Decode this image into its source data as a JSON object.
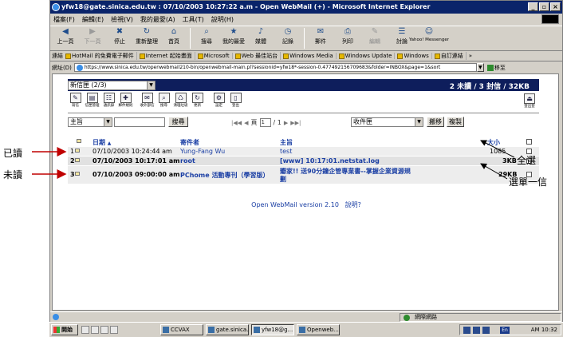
{
  "window": {
    "title": "yfw18@gate.sinica.edu.tw : 07/10/2003 10:27:22 a.m - Open WebMail (+) - Microsoft Internet Explorer",
    "buttons": [
      "_",
      "▫",
      "×"
    ]
  },
  "menu": [
    "檔案(F)",
    "編輯(E)",
    "檢視(V)",
    "我的最愛(A)",
    "工具(T)",
    "說明(H)"
  ],
  "toolbar": [
    {
      "label": "上一頁",
      "icon": "back-icon",
      "disabled": false
    },
    {
      "label": "下一頁",
      "icon": "forward-icon",
      "disabled": true
    },
    {
      "label": "停止",
      "icon": "stop-icon",
      "disabled": false
    },
    {
      "label": "重新整理",
      "icon": "refresh-icon",
      "disabled": false
    },
    {
      "label": "首頁",
      "icon": "home-icon",
      "disabled": false
    },
    {
      "label": "搜尋",
      "icon": "search-icon",
      "disabled": false
    },
    {
      "label": "我的最愛",
      "icon": "favorites-icon",
      "disabled": false
    },
    {
      "label": "媒體",
      "icon": "media-icon",
      "disabled": false
    },
    {
      "label": "記錄",
      "icon": "history-icon",
      "disabled": false
    },
    {
      "label": "郵件",
      "icon": "mail-icon",
      "disabled": false
    },
    {
      "label": "列印",
      "icon": "print-icon",
      "disabled": false
    },
    {
      "label": "編輯",
      "icon": "edit-icon",
      "disabled": true
    },
    {
      "label": "討論",
      "icon": "discuss-icon",
      "disabled": false
    },
    {
      "label": "Yahoo! Messenger",
      "icon": "messenger-icon",
      "disabled": false
    }
  ],
  "links": {
    "label": "連結",
    "items": [
      "HotMail 的免費電子郵件",
      "Internet 起始畫面",
      "Microsoft",
      "Web 最佳站台",
      "Windows Media",
      "Windows Update",
      "Windows",
      "自訂連結"
    ],
    "more": "»"
  },
  "address": {
    "label": "網址(D)",
    "url": "https://www.sinica.edu.tw/openwebmail210-bin/openwebmail-main.pl?sessionid=yfw18*-session-0.477492156709683&folder=INBOX&page=1&sort",
    "go": "移至"
  },
  "webmail": {
    "folder_select": "新信匣 (2/3)",
    "status": "2 未讀 / 3 封信 / 32KB",
    "icons": [
      {
        "name": "compose-icon",
        "label": "寫信",
        "glyph": "✎"
      },
      {
        "name": "folders-icon",
        "label": "信匣管理",
        "glyph": "▤"
      },
      {
        "name": "addressbook-icon",
        "label": "通訊錄",
        "glyph": "☷"
      },
      {
        "name": "filter-icon",
        "label": "郵件規則",
        "glyph": "✚"
      },
      {
        "name": "pop3-icon",
        "label": "收外部信",
        "glyph": "✉"
      },
      {
        "name": "search-mail-icon",
        "label": "搜尋",
        "glyph": "⌕"
      },
      {
        "name": "trash-icon",
        "label": "清理垃圾",
        "glyph": "♺"
      },
      {
        "name": "update-icon",
        "label": "更新",
        "glyph": "↻"
      },
      {
        "name": "settings-icon",
        "label": "設定",
        "glyph": "⚙"
      },
      {
        "name": "logout-door-icon",
        "label": "登出",
        "glyph": "▯"
      }
    ],
    "logout_label": "登出登",
    "search": {
      "field_select": "主旨",
      "keyword": "",
      "button": "搜尋",
      "page_label": "頁",
      "page_value": "1",
      "page_total": "/ 1",
      "move_target": "收件匣",
      "move_button": "搬移",
      "copy_button": "複製"
    },
    "columns": {
      "date": "日期",
      "sort_marker": "▲",
      "sender": "寄件者",
      "subject": "主旨",
      "size": "大小"
    },
    "messages": [
      {
        "num": "1",
        "date": "07/10/2003 10:24:44 am",
        "sender": "Yung-Fang Wu",
        "subject": "test",
        "subject2": "",
        "size": "1085",
        "checked": false,
        "read": true
      },
      {
        "num": "2",
        "date": "07/10/2003 10:17:01 am",
        "sender": "root",
        "subject": "[www] 10:17:01.netstat.log",
        "subject2": "",
        "size": "3KB",
        "checked": true,
        "read": false
      },
      {
        "num": "3",
        "date": "07/10/2003 09:00:00 am",
        "sender": "PChome 活動專刊（學習版）",
        "subject": "瓣家!! 送90分鐘企管專業書--掌握企業資源規",
        "subject2": "劃",
        "size": "29KB",
        "checked": false,
        "read": false
      }
    ],
    "footer": {
      "version": "Open WebMail version 2.10",
      "help": "說明?"
    }
  },
  "statusbar": {
    "zone": "網際網路"
  },
  "taskbar": {
    "start": "開始",
    "tasks": [
      "CCVAX",
      "gate.sinica...",
      "yfw18@g...",
      "Openweb..."
    ],
    "active_task": 2,
    "time": "AM 10:32",
    "ime": "En"
  },
  "annotations": {
    "read": "已讀",
    "unread": "未讀",
    "select_all": "全選",
    "select_one": "選單一信"
  },
  "colors": {
    "header_bar": "#0e1e5c",
    "link_blue": "#1b3fa4",
    "title_blue": "#0a246a"
  }
}
